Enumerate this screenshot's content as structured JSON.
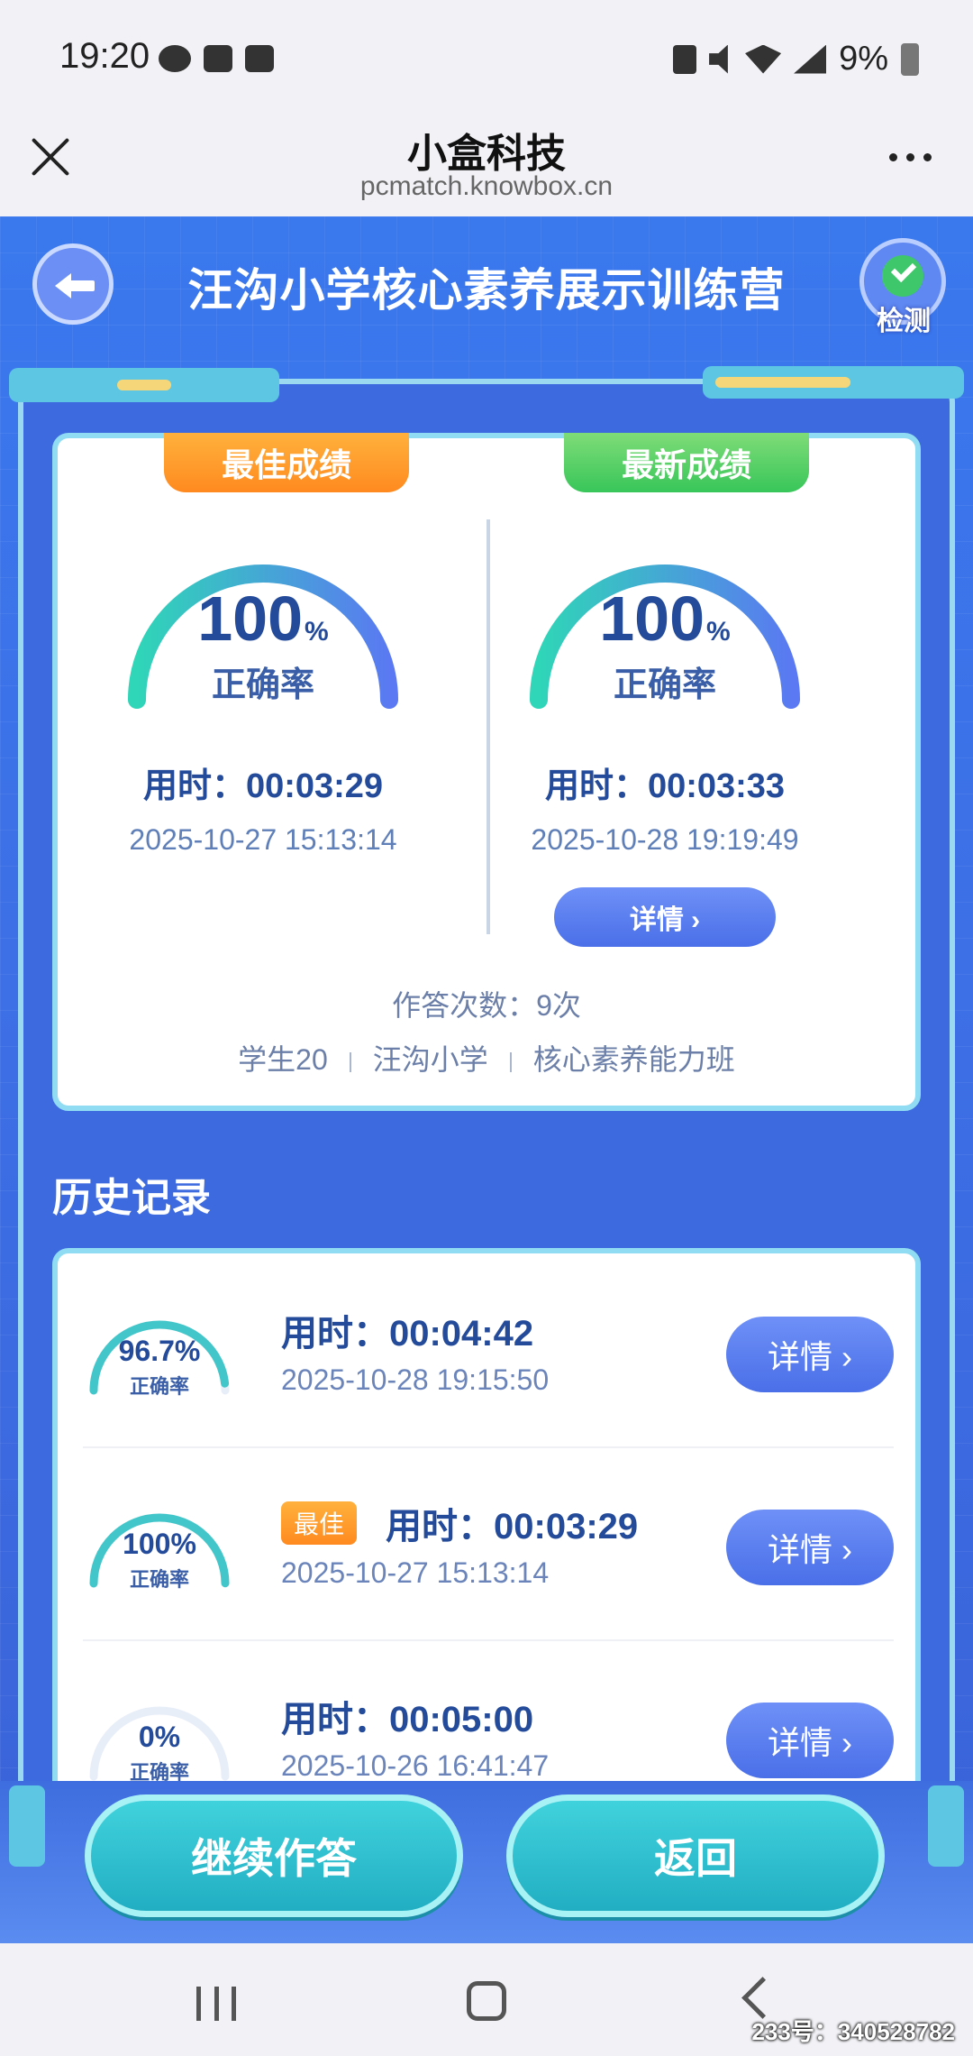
{
  "status_bar": {
    "time": "19:20",
    "battery": "9%"
  },
  "header": {
    "title": "小盒科技",
    "url": "pcmatch.knowbox.cn"
  },
  "app": {
    "title": "汪沟小学核心素养展示训练营",
    "check_label": "检测"
  },
  "summary": {
    "best": {
      "tag": "最佳成绩",
      "percent": "100",
      "percent_sign": "%",
      "accuracy_label": "正确率",
      "time": "用时：00:03:29",
      "date": "2025-10-27 15:13:14",
      "fill": 1.0
    },
    "latest": {
      "tag": "最新成绩",
      "percent": "100",
      "percent_sign": "%",
      "accuracy_label": "正确率",
      "time": "用时：00:03:33",
      "date": "2025-10-28 19:19:49",
      "detail": "详情 ›",
      "fill": 1.0
    },
    "attempts": "作答次数：9次",
    "student": "学生20",
    "school": "汪沟小学",
    "class": "核心素养能力班"
  },
  "history": {
    "title": "历史记录",
    "rows": [
      {
        "percent": "96.7%",
        "label": "正确率",
        "time": "用时：00:04:42",
        "date": "2025-10-28 19:15:50",
        "best": "",
        "detail": "详情 ›",
        "fill": 0.967
      },
      {
        "percent": "100%",
        "label": "正确率",
        "time": "用时：00:03:29",
        "date": "2025-10-27 15:13:14",
        "best": "最佳",
        "detail": "详情 ›",
        "fill": 1.0
      },
      {
        "percent": "0%",
        "label": "正确率",
        "time": "用时：00:05:00",
        "date": "2025-10-26 16:41:47",
        "best": "",
        "detail": "详情 ›",
        "fill": 0.0
      }
    ]
  },
  "buttons": {
    "continue": "继续作答",
    "back": "返回"
  },
  "watermark": "233号：340528782",
  "colors": {
    "primary_blue": "#3a78ee",
    "best_orange": "#ff8a1f",
    "latest_green": "#38c65a",
    "teal": "#21aec3"
  }
}
